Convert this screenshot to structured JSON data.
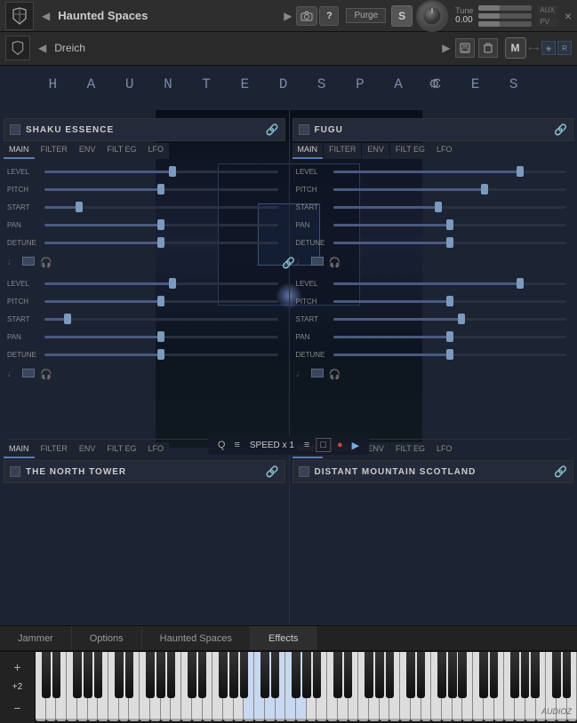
{
  "window": {
    "title": "Haunted Spaces",
    "preset": "Dreich",
    "close_btn": "×",
    "min_btn": "−"
  },
  "header": {
    "instrument_name": "Haunted Spaces",
    "preset_name": "Dreich",
    "camera_icon": "📷",
    "help_icon": "?",
    "purge_label": "Purge",
    "s_label": "S",
    "m_label": "M",
    "tune_label": "Tune",
    "tune_value": "0.00",
    "aux_label": "AUX",
    "pv_label": "PV"
  },
  "main_title": "H A U N T E D   S P A C E S",
  "instruments": [
    {
      "id": "top-left",
      "name": "SHAKU ESSENCE",
      "tabs": [
        "MAIN",
        "FILTER",
        "ENV",
        "FILT EG",
        "LFO"
      ],
      "active_tab": "MAIN",
      "sliders": [
        {
          "label": "LEVEL",
          "fill_pct": 55
        },
        {
          "label": "PITCH",
          "fill_pct": 50
        },
        {
          "label": "START",
          "fill_pct": 15
        },
        {
          "label": "PAN",
          "fill_pct": 50
        },
        {
          "label": "DETUNE",
          "fill_pct": 50
        }
      ],
      "icons": [
        "♩",
        "▪",
        "🎧"
      ]
    },
    {
      "id": "top-right",
      "name": "FUGU",
      "tabs": [
        "MAIN",
        "FILTER",
        "ENV",
        "FILT EG",
        "LFO"
      ],
      "active_tab": "MAIN",
      "sliders": [
        {
          "label": "LEVEL",
          "fill_pct": 80
        },
        {
          "label": "PITCH",
          "fill_pct": 65
        },
        {
          "label": "START",
          "fill_pct": 45
        },
        {
          "label": "PAN",
          "fill_pct": 50
        },
        {
          "label": "DETUNE",
          "fill_pct": 50
        }
      ],
      "icons": [
        "♩",
        "▪",
        "🎧"
      ]
    },
    {
      "id": "bottom-left",
      "name": "THE NORTH TOWER",
      "tabs": [
        "MAIN",
        "FILTER",
        "ENV",
        "FILT EG",
        "LFO"
      ],
      "active_tab": "MAIN",
      "sliders": [
        {
          "label": "LEVEL",
          "fill_pct": 50
        },
        {
          "label": "PITCH",
          "fill_pct": 50
        },
        {
          "label": "START",
          "fill_pct": 15
        },
        {
          "label": "PAN",
          "fill_pct": 50
        },
        {
          "label": "DETUNE",
          "fill_pct": 50
        }
      ],
      "icons": [
        "♩",
        "▪",
        "🎧"
      ]
    },
    {
      "id": "bottom-right",
      "name": "DISTANT MOUNTAIN SCOTLAND",
      "tabs": [
        "MAIN",
        "FILTER",
        "ENV",
        "FILT EG",
        "LFO"
      ],
      "active_tab": "MAIN",
      "sliders": [
        {
          "label": "LEVEL",
          "fill_pct": 80
        },
        {
          "label": "PITCH",
          "fill_pct": 50
        },
        {
          "label": "START",
          "fill_pct": 55
        },
        {
          "label": "PAN",
          "fill_pct": 50
        },
        {
          "label": "DETUNE",
          "fill_pct": 50
        }
      ],
      "icons": [
        "♩",
        "▪",
        "🎧"
      ]
    }
  ],
  "transport": {
    "q_label": "Q",
    "list_icon": "≡",
    "speed_label": "SPEED x 1",
    "menu_icon": "≡",
    "folder_icon": "□",
    "record_icon": "●",
    "play_icon": "▶"
  },
  "bottom_tabs": [
    {
      "label": "Jammer",
      "active": false
    },
    {
      "label": "Options",
      "active": false
    },
    {
      "label": "Haunted Spaces",
      "active": false
    },
    {
      "label": "Effects",
      "active": true
    }
  ],
  "piano": {
    "pitch_label": "+2",
    "pitch_value": "+2",
    "octave_minus": "−",
    "white_keys": 52,
    "audioz_label": "AUDIOZ"
  }
}
